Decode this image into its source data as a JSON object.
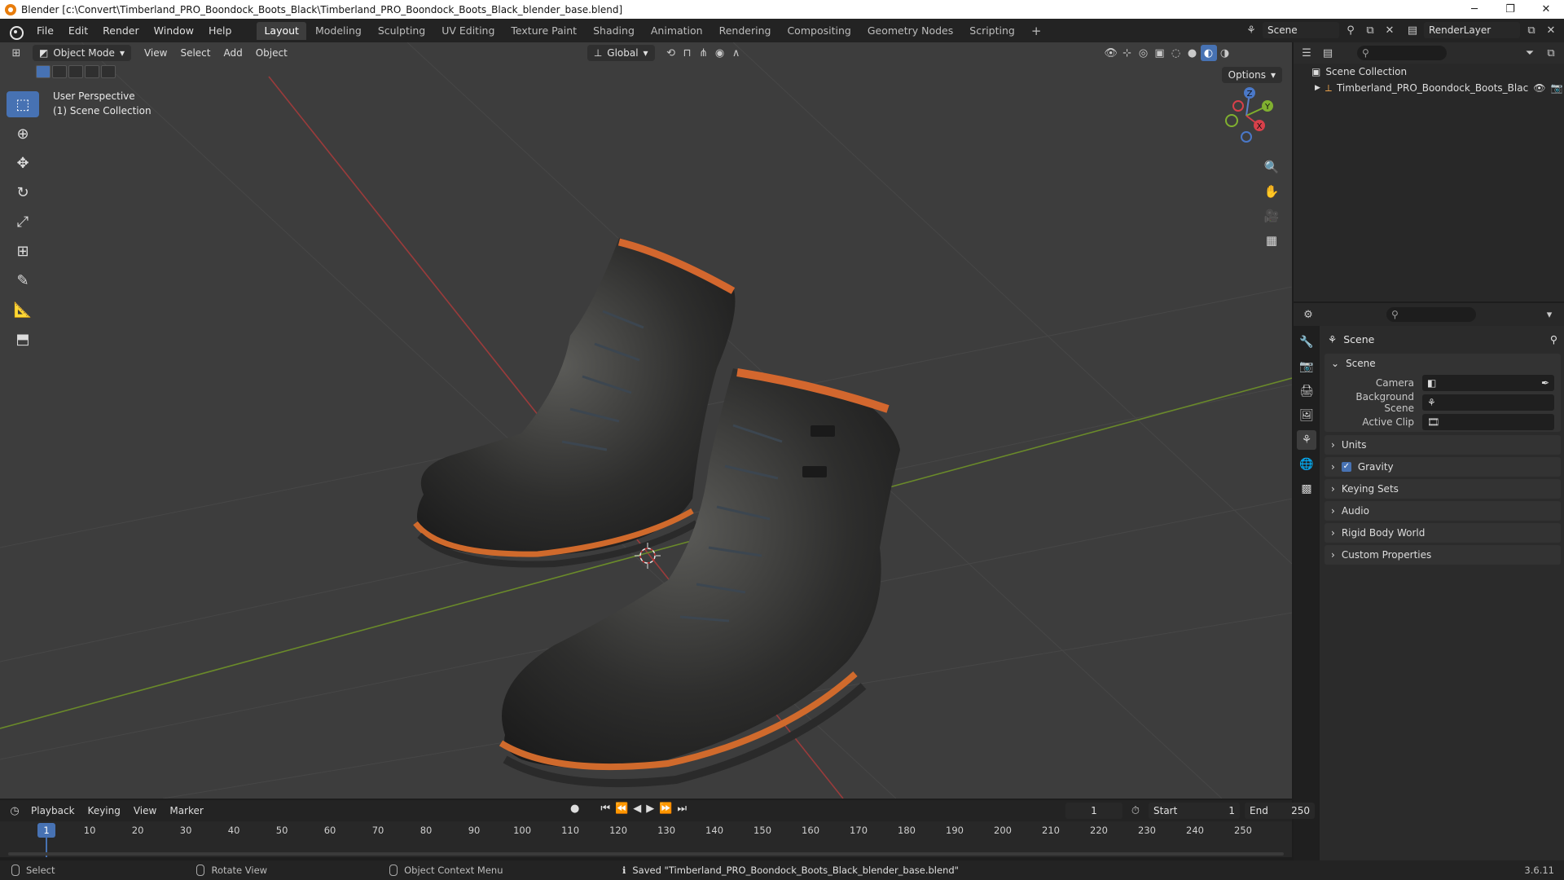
{
  "window": {
    "title": "Blender [c:\\Convert\\Timberland_PRO_Boondock_Boots_Black\\Timberland_PRO_Boondock_Boots_Black_blender_base.blend]",
    "controls": [
      "─",
      "❐",
      "✕"
    ]
  },
  "menu": [
    "File",
    "Edit",
    "Render",
    "Window",
    "Help"
  ],
  "workspaces": [
    "Layout",
    "Modeling",
    "Sculpting",
    "UV Editing",
    "Texture Paint",
    "Shading",
    "Animation",
    "Rendering",
    "Compositing",
    "Geometry Nodes",
    "Scripting"
  ],
  "active_workspace": "Layout",
  "scene_name": "Scene",
  "render_layer": "RenderLayer",
  "viewport": {
    "mode": "Object Mode",
    "menus": [
      "View",
      "Select",
      "Add",
      "Object"
    ],
    "transform_orientation": "Global",
    "options_label": "Options",
    "perspective_label": "User Perspective",
    "collection_label": "(1) Scene Collection",
    "gizmo_axes": [
      "Z",
      "Y",
      "X"
    ]
  },
  "outliner": {
    "root": "Scene Collection",
    "item": "Timberland_PRO_Boondock_Boots_Blac"
  },
  "properties": {
    "context": "Scene",
    "scene_panel": {
      "title": "Scene",
      "camera_label": "Camera",
      "background_label": "Background Scene",
      "clip_label": "Active Clip"
    },
    "panels": [
      "Units",
      "Gravity",
      "Keying Sets",
      "Audio",
      "Rigid Body World",
      "Custom Properties"
    ]
  },
  "timeline": {
    "menus": [
      "Playback",
      "Keying",
      "View",
      "Marker"
    ],
    "current_frame": "1",
    "start_label": "Start",
    "start": "1",
    "end_label": "End",
    "end": "250",
    "ticks": [
      "1",
      "10",
      "20",
      "30",
      "40",
      "50",
      "60",
      "70",
      "80",
      "90",
      "100",
      "110",
      "120",
      "130",
      "140",
      "150",
      "160",
      "170",
      "180",
      "190",
      "200",
      "210",
      "220",
      "230",
      "240",
      "250"
    ]
  },
  "status": {
    "select": "Select",
    "rotate": "Rotate View",
    "context_menu": "Object Context Menu",
    "saved_message": "Saved \"Timberland_PRO_Boondock_Boots_Black_blender_base.blend\"",
    "version": "3.6.11"
  }
}
